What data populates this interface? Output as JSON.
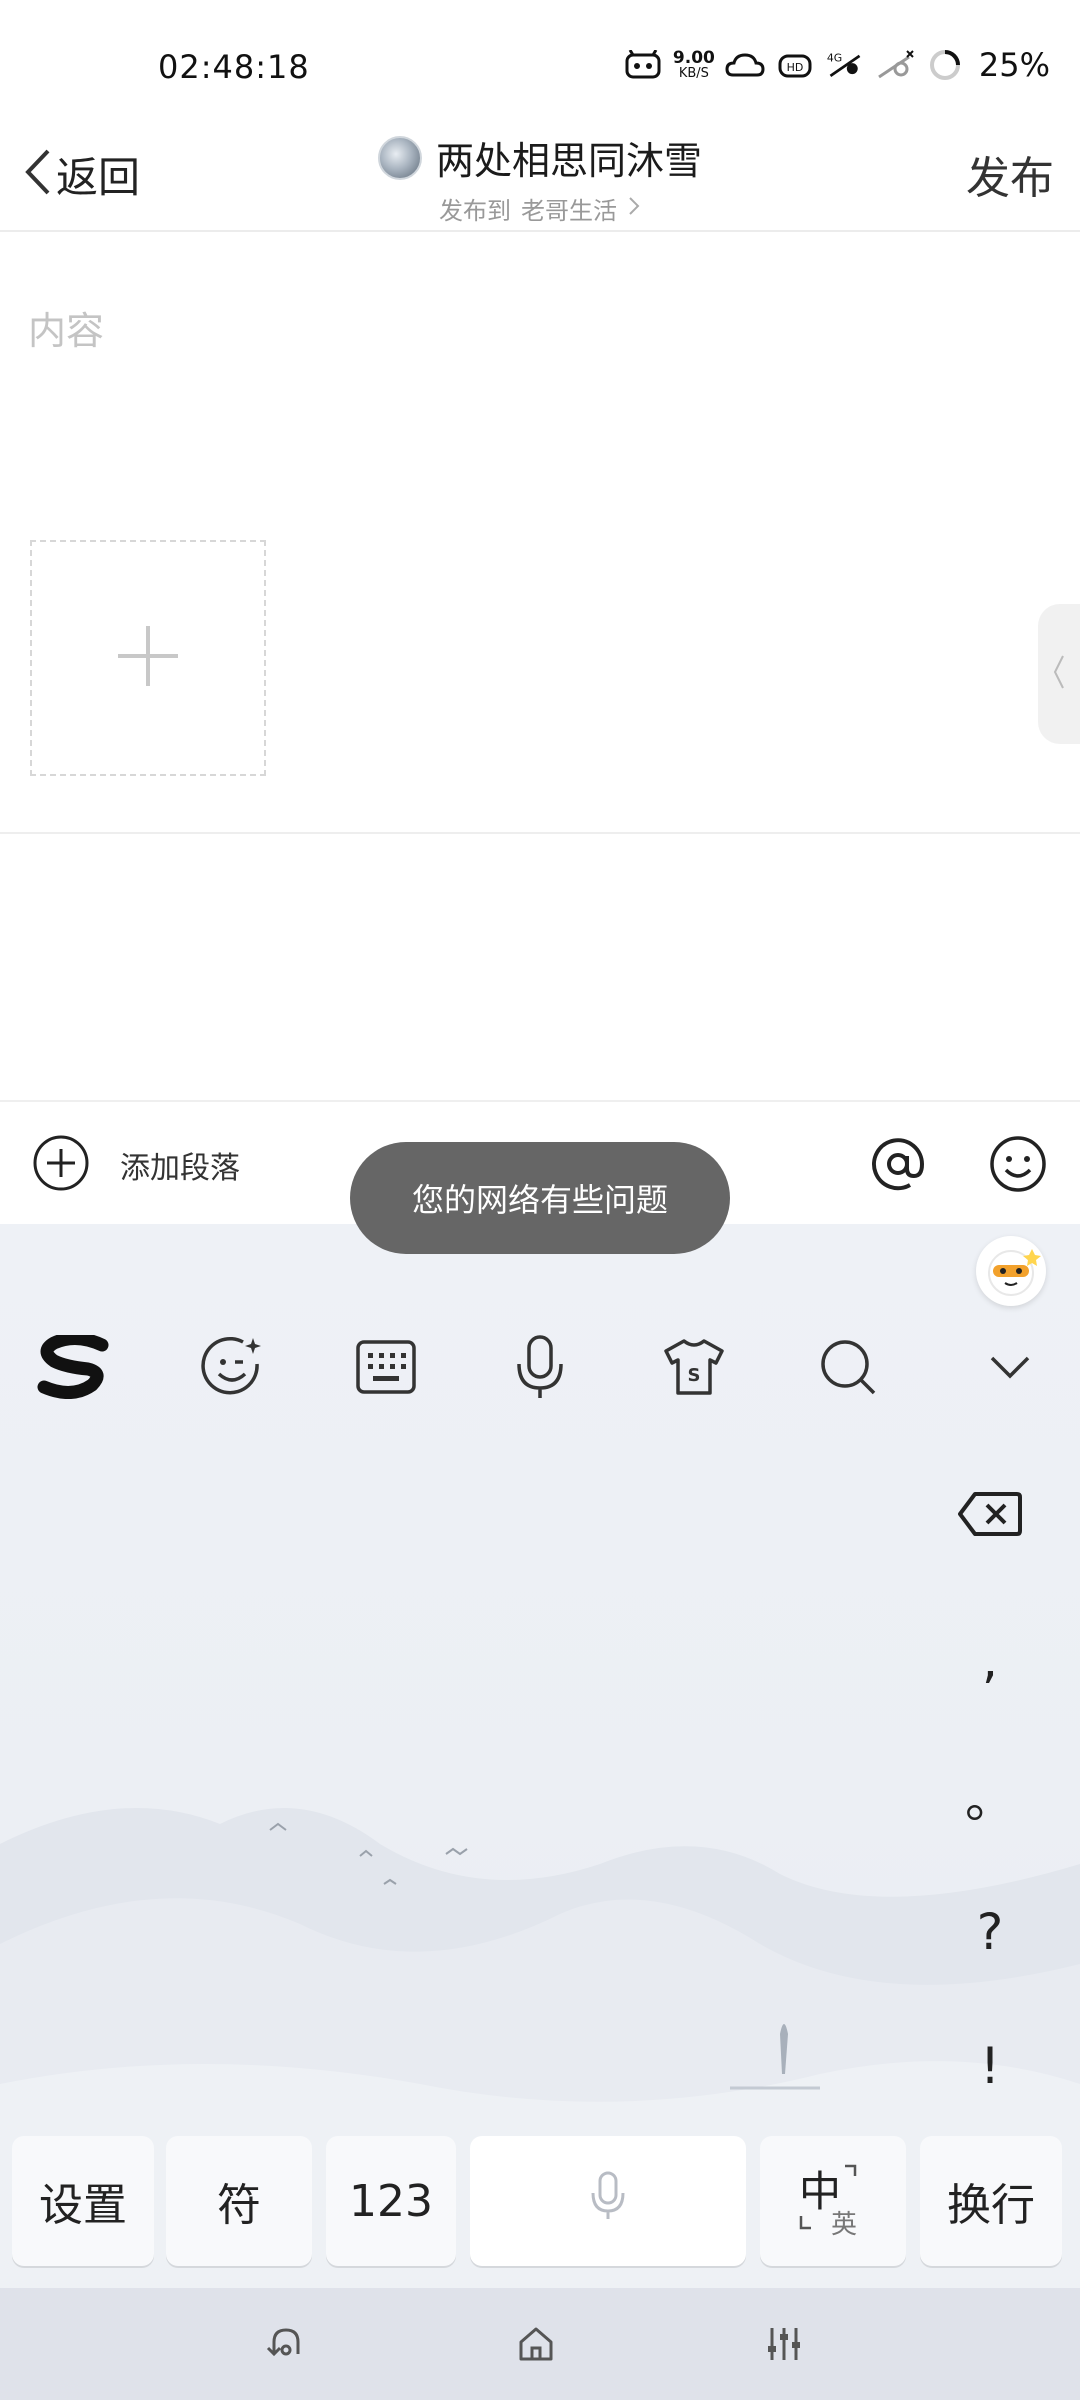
{
  "status_bar": {
    "time": "02:48:18",
    "net_speed_value": "9.00",
    "net_speed_unit": "KB/S",
    "network_type": "4G",
    "battery": "25%"
  },
  "header": {
    "back_label": "返回",
    "title": "两处相思同沐雪",
    "subtitle_prefix": "发布到",
    "subtitle_target": "老哥生活",
    "publish_label": "发布"
  },
  "editor": {
    "content_placeholder": "内容"
  },
  "toolbar": {
    "add_paragraph_label": "添加段落"
  },
  "toast": {
    "message": "您的网络有些问题"
  },
  "keyboard": {
    "side_keys": [
      ",",
      "。",
      "?",
      "!"
    ],
    "bottom_row": {
      "settings": "设置",
      "symbols": "符",
      "numbers": "123",
      "lang_cn": "中",
      "lang_en": "英",
      "enter": "换行"
    }
  },
  "colors": {
    "toast_bg": "#666666",
    "keyboard_bg": "#eef1f6",
    "nav_bg": "#dfe2ea"
  }
}
